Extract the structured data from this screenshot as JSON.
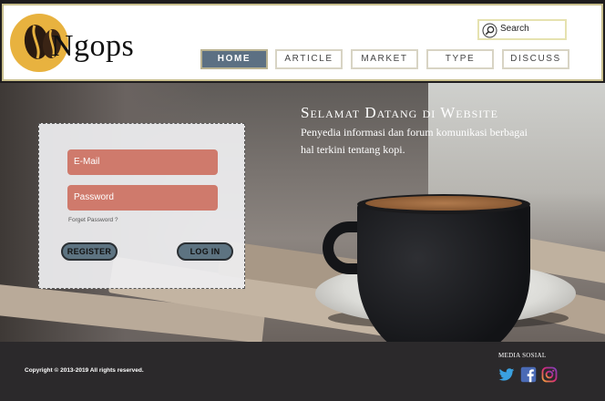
{
  "brand": {
    "name": "Ngops"
  },
  "search": {
    "placeholder": "Search"
  },
  "nav": {
    "items": [
      {
        "label": "HOME",
        "active": true
      },
      {
        "label": "ARTICLE",
        "active": false
      },
      {
        "label": "MARKET",
        "active": false
      },
      {
        "label": "TYPE",
        "active": false
      },
      {
        "label": "DISCUSS",
        "active": false
      }
    ]
  },
  "hero": {
    "title": "Selamat Datang di Website",
    "subtitle": "Penyedia informasi dan forum komunikasi berbagai hal terkini tentang kopi."
  },
  "login": {
    "email_placeholder": "E-Mail",
    "password_placeholder": "Password",
    "forgot_label": "Forget Password ?",
    "register_label": "REGISTER",
    "login_label": "LOG IN"
  },
  "footer": {
    "copyright": "Copyright © 2013-2019  All rights reserved.",
    "social_title": "MEDIA SOSIAL",
    "social_icons": [
      "twitter-icon",
      "facebook-icon",
      "instagram-icon"
    ]
  },
  "colors": {
    "nav_active": "#5c7083",
    "input_fill": "#cf7a6c",
    "button_fill": "#5d7381",
    "footer_bg": "#2b292b",
    "logo_circle": "#e8b23f",
    "twitter": "#3aa0e0",
    "facebook": "#4a6ab5",
    "instagram": "#c23a9a"
  }
}
